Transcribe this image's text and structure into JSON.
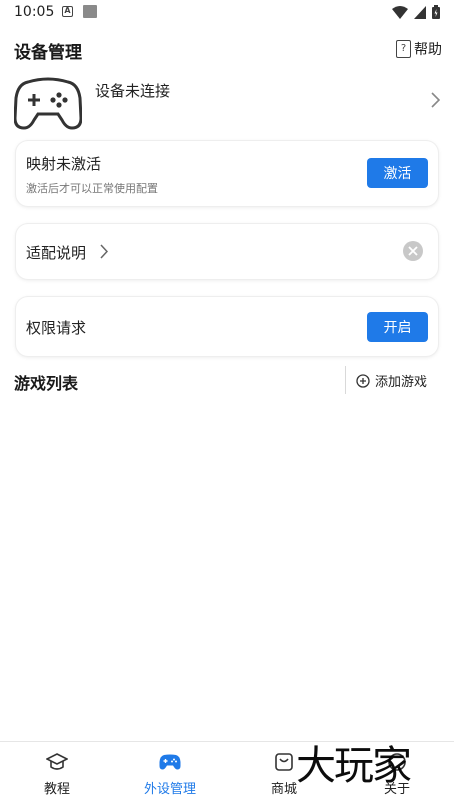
{
  "status_bar": {
    "time": "10:05",
    "left_icons": [
      "a-notification-icon",
      "image-notification-icon"
    ],
    "right_icons": [
      "wifi-icon",
      "signal-icon",
      "battery-icon"
    ]
  },
  "header": {
    "title": "设备管理",
    "help_label": "帮助",
    "help_icon_glyph": "?"
  },
  "device": {
    "icon": "gamepad-icon",
    "status": "设备未连接"
  },
  "activation_card": {
    "title": "映射未激活",
    "subtitle": "激活后才可以正常使用配置",
    "button_label": "激活"
  },
  "adapt_card": {
    "title": "适配说明"
  },
  "permission_card": {
    "title": "权限请求",
    "button_label": "开启"
  },
  "games": {
    "title": "游戏列表",
    "add_label": "添加游戏"
  },
  "bottom_nav": {
    "items": [
      {
        "label": "教程",
        "icon": "graduation-cap-icon",
        "active": false
      },
      {
        "label": "外设管理",
        "icon": "gamepad-icon",
        "active": true
      },
      {
        "label": "商城",
        "icon": "shopping-bag-icon",
        "active": false
      },
      {
        "label": "关于",
        "icon": "info-icon",
        "active": false
      }
    ]
  },
  "watermark": "大玩家",
  "colors": {
    "accent": "#1f7ae8",
    "text": "#222222",
    "muted": "#777777",
    "close_circle": "#c8c8c8"
  }
}
